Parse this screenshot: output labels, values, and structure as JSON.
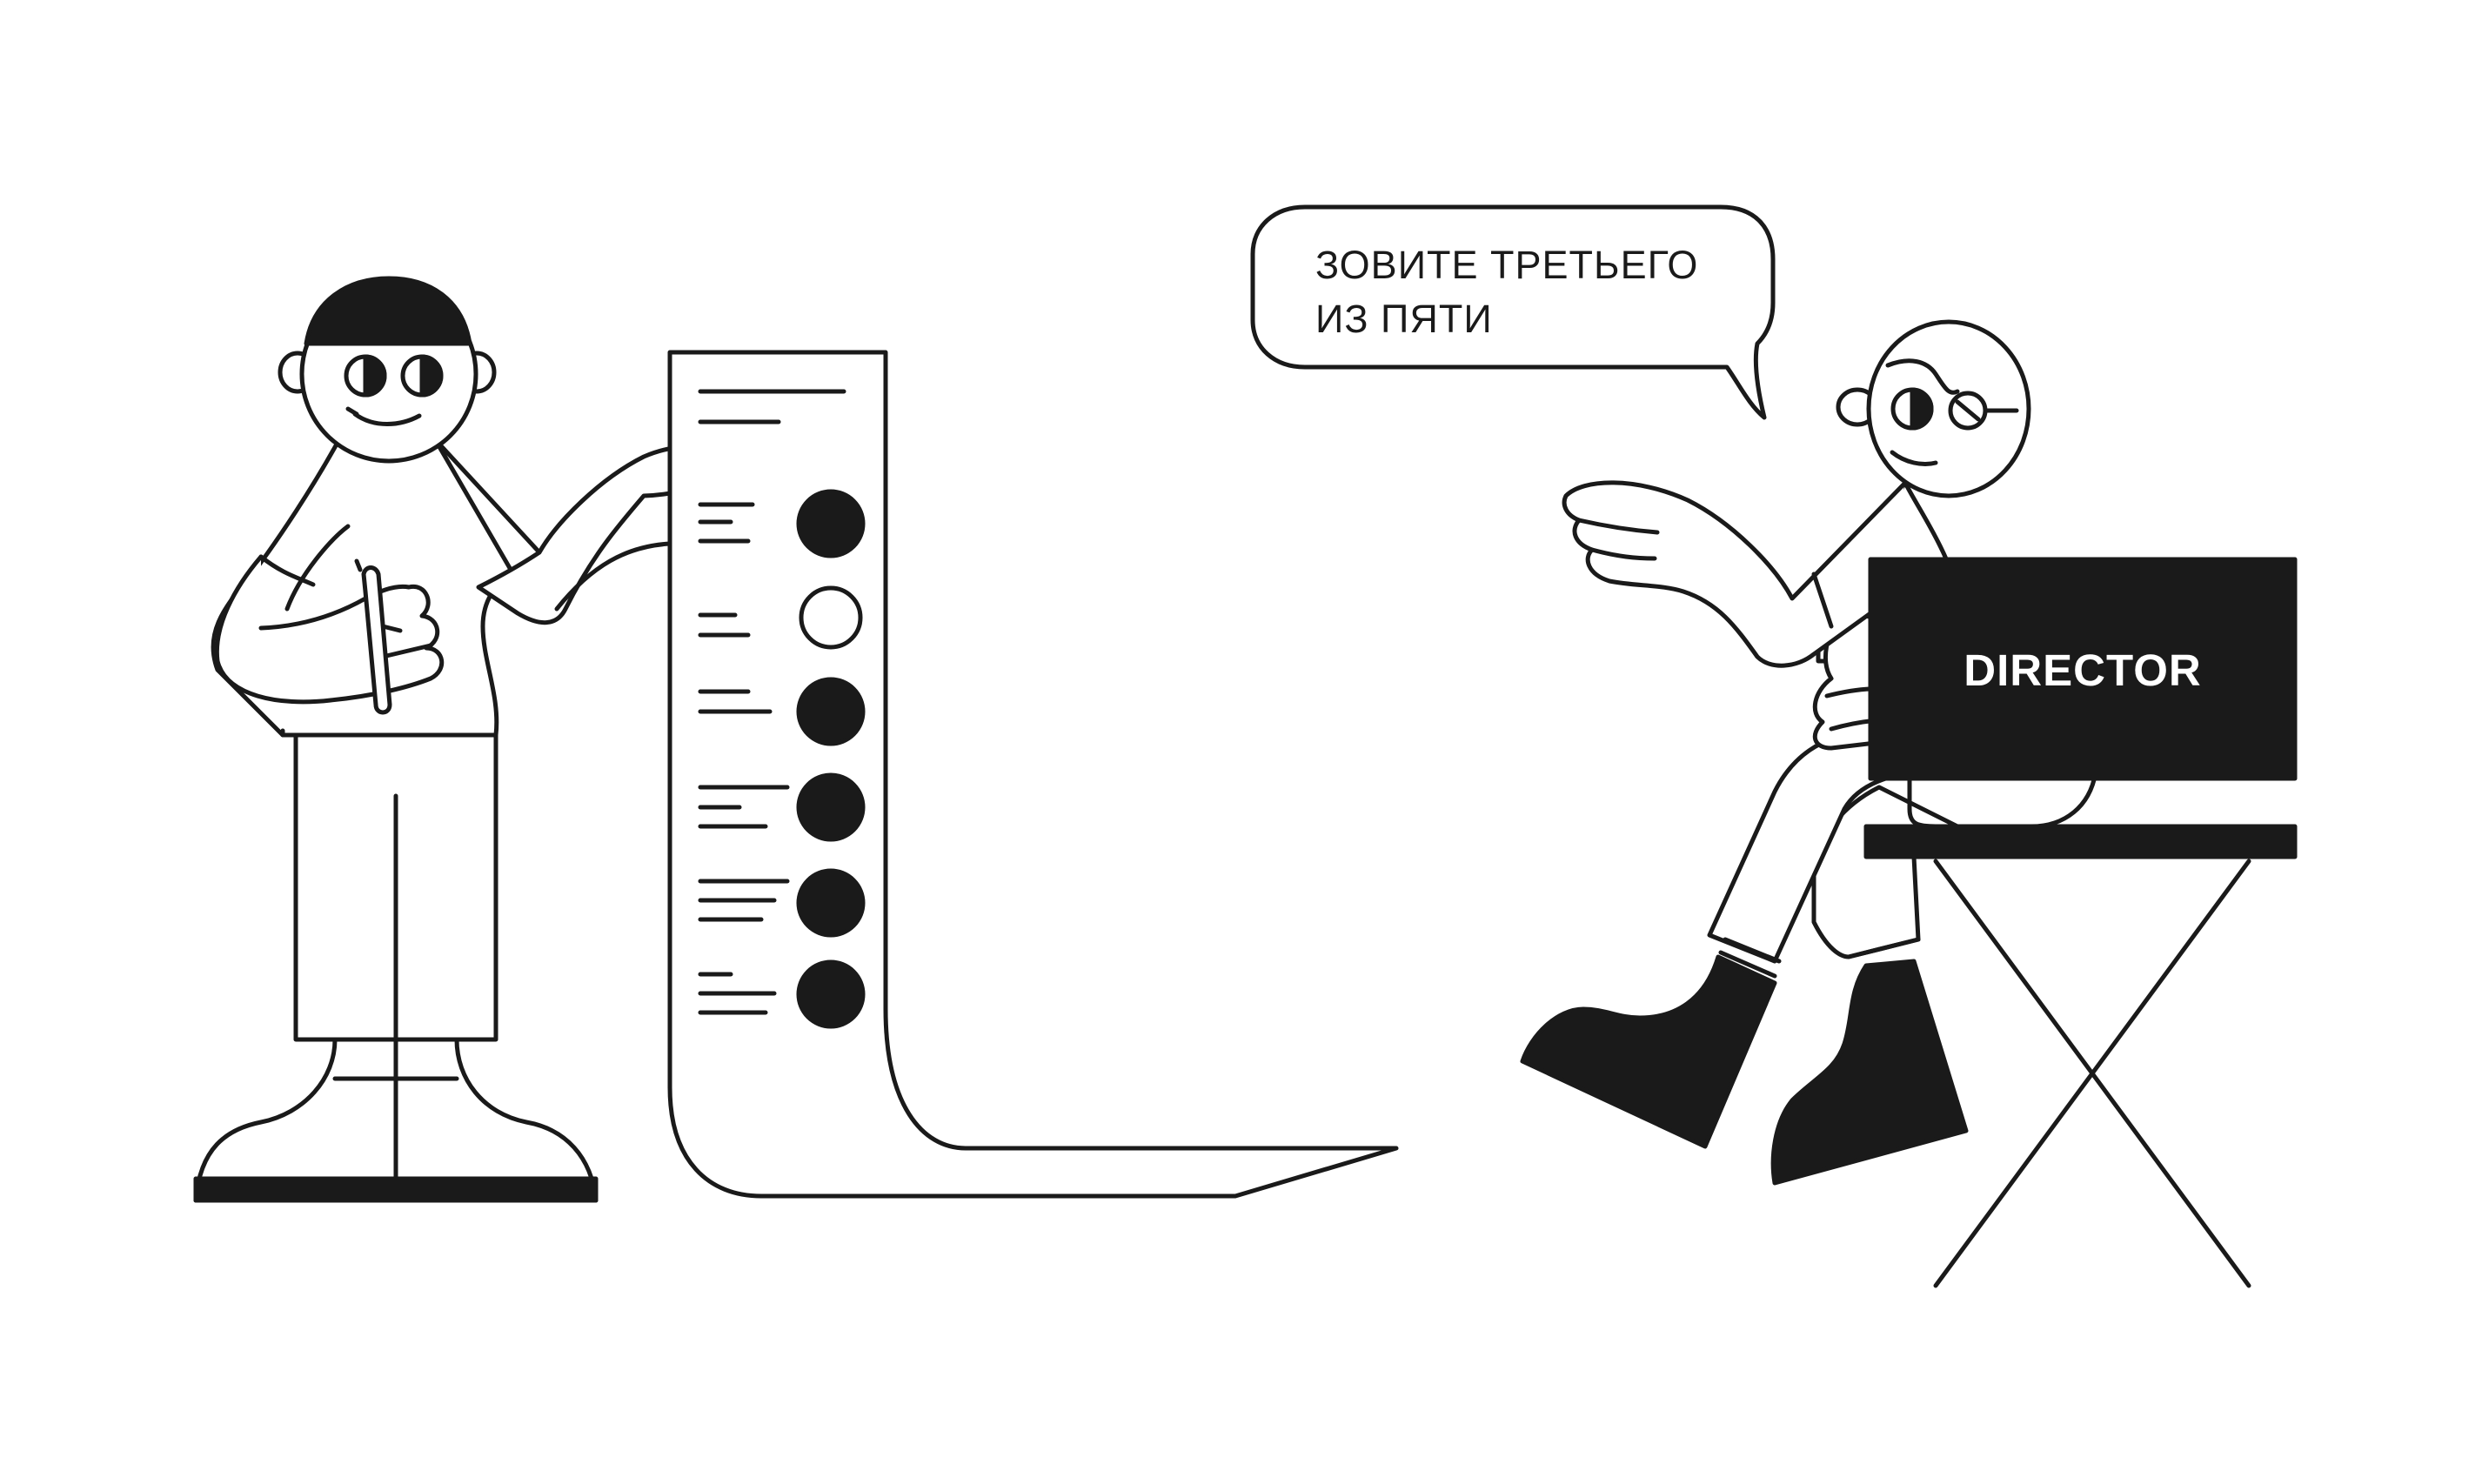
{
  "speech_bubble": {
    "line1": "ЗОВИТЕ ТРЕТЬЕГО",
    "line2": "ИЗ ПЯТИ"
  },
  "director_chair": {
    "label": "DIRECTOR"
  },
  "candidate_list": {
    "candidates": [
      {
        "status": "filled"
      },
      {
        "status": "empty"
      },
      {
        "status": "filled"
      },
      {
        "status": "filled"
      },
      {
        "status": "filled"
      },
      {
        "status": "filled"
      }
    ]
  },
  "colors": {
    "ink": "#1a1a1a",
    "background": "#ffffff"
  }
}
